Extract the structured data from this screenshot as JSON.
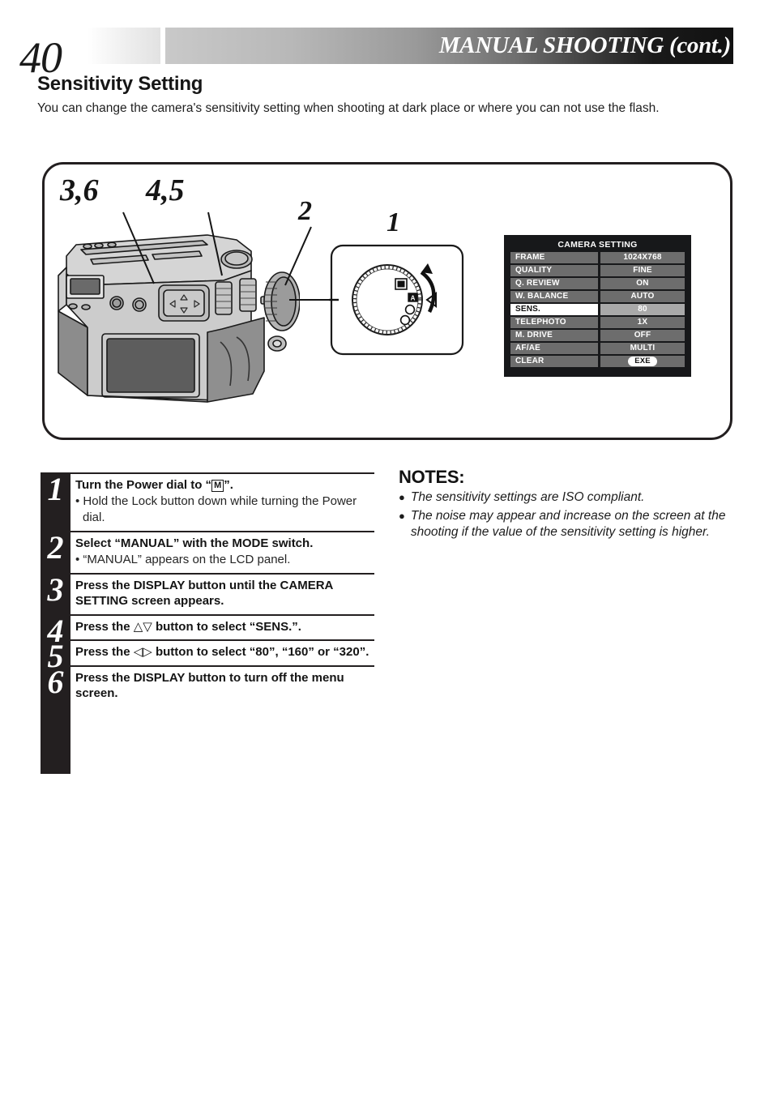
{
  "header": {
    "page_number": "40",
    "title": "MANUAL SHOOTING (cont.)"
  },
  "section": {
    "title": "Sensitivity Setting",
    "intro": "You can change the camera's sensitivity setting when shooting at dark place or where you can not use the flash."
  },
  "illustration": {
    "callouts": [
      {
        "id": "callout-36",
        "label": "3,6"
      },
      {
        "id": "callout-45",
        "label": "4,5"
      },
      {
        "id": "callout-2",
        "label": "2"
      },
      {
        "id": "callout-1",
        "label": "1"
      }
    ]
  },
  "camera_menu": {
    "title": "CAMERA SETTING",
    "rows": [
      {
        "label": "FRAME",
        "value": "1024X768",
        "selected": false
      },
      {
        "label": "QUALITY",
        "value": "FINE",
        "selected": false
      },
      {
        "label": "Q. REVIEW",
        "value": "ON",
        "selected": false
      },
      {
        "label": "W. BALANCE",
        "value": "AUTO",
        "selected": false
      },
      {
        "label": "SENS.",
        "value": "80",
        "selected": true
      },
      {
        "label": "TELEPHOTO",
        "value": "1X",
        "selected": false
      },
      {
        "label": "M. DRIVE",
        "value": "OFF",
        "selected": false
      },
      {
        "label": "AF/AE",
        "value": "MULTI",
        "selected": false
      },
      {
        "label": "CLEAR",
        "value": "EXE",
        "selected": false,
        "pill": true
      }
    ]
  },
  "steps": [
    {
      "number": "1",
      "main_before": "Turn the Power dial to “",
      "main_box": "M",
      "main_after": "”.",
      "sub": "• Hold the Lock button down while turning the Power dial."
    },
    {
      "number": "2",
      "main_before": "Select “MANUAL” with the MODE switch.",
      "main_box": "",
      "main_after": "",
      "sub": "• “MANUAL” appears on the LCD panel."
    },
    {
      "number": "3",
      "main_before": "Press the DISPLAY button until the CAMERA SETTING screen appears.",
      "main_box": "",
      "main_after": "",
      "sub": ""
    },
    {
      "number": "4",
      "main_before": "Press the ",
      "main_glyph": "△▽",
      "main_after": " button to select “SENS.”.",
      "sub": ""
    },
    {
      "number": "5",
      "main_before": "Press the ",
      "main_glyph": "◁▷",
      "main_after": " button to select “80”, “160” or “320”.",
      "sub": ""
    },
    {
      "number": "6",
      "main_before": "Press the DISPLAY button to turn off the menu screen.",
      "main_box": "",
      "main_after": "",
      "sub": ""
    }
  ],
  "notes": {
    "title": "NOTES:",
    "bullet": "●",
    "items": [
      "The sensitivity settings are ISO compliant.",
      "The noise may appear and increase on the screen at the shooting if the value of the sensitivity setting is higher."
    ]
  }
}
